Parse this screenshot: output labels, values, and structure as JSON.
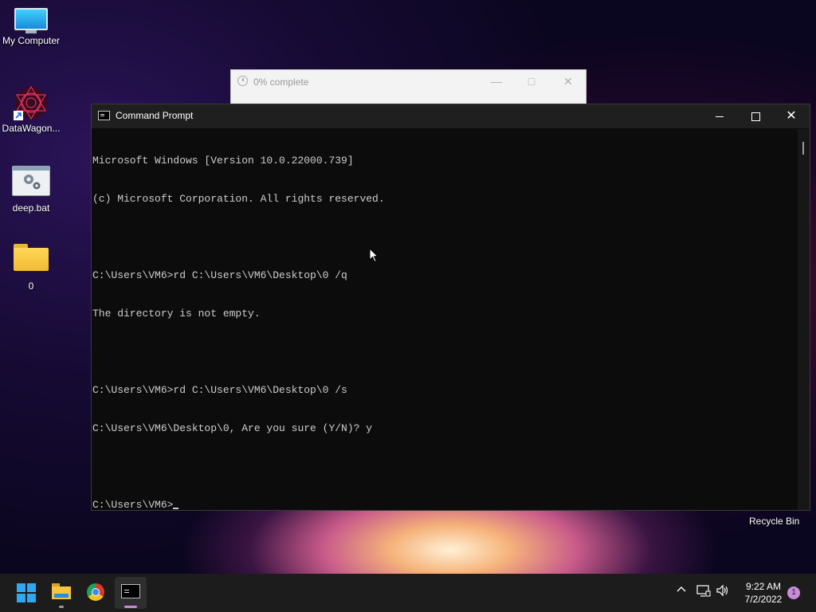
{
  "desktop": {
    "icons": [
      {
        "label": "My Computer"
      },
      {
        "label": "DataWagon..."
      },
      {
        "label": "deep.bat"
      },
      {
        "label": "0"
      }
    ],
    "recycle_bin": "Recycle Bin"
  },
  "progress_dialog": {
    "title": "0% complete",
    "progress": 0
  },
  "cmd_window": {
    "title": "Command Prompt",
    "lines": [
      "Microsoft Windows [Version 10.0.22000.739]",
      "(c) Microsoft Corporation. All rights reserved.",
      "",
      "C:\\Users\\VM6>rd C:\\Users\\VM6\\Desktop\\0 /q",
      "The directory is not empty.",
      "",
      "C:\\Users\\VM6>rd C:\\Users\\VM6\\Desktop\\0 /s",
      "C:\\Users\\VM6\\Desktop\\0, Are you sure (Y/N)? y",
      "",
      "C:\\Users\\VM6>"
    ]
  },
  "taskbar": {
    "apps": [
      "start",
      "file-explorer",
      "chrome",
      "command-prompt"
    ],
    "time": "9:22 AM",
    "date": "7/2/2022",
    "notification_count": "1"
  },
  "colors": {
    "accent": "#2ea8f0",
    "console_bg": "#0c0c0c",
    "console_text": "#cccccc"
  }
}
